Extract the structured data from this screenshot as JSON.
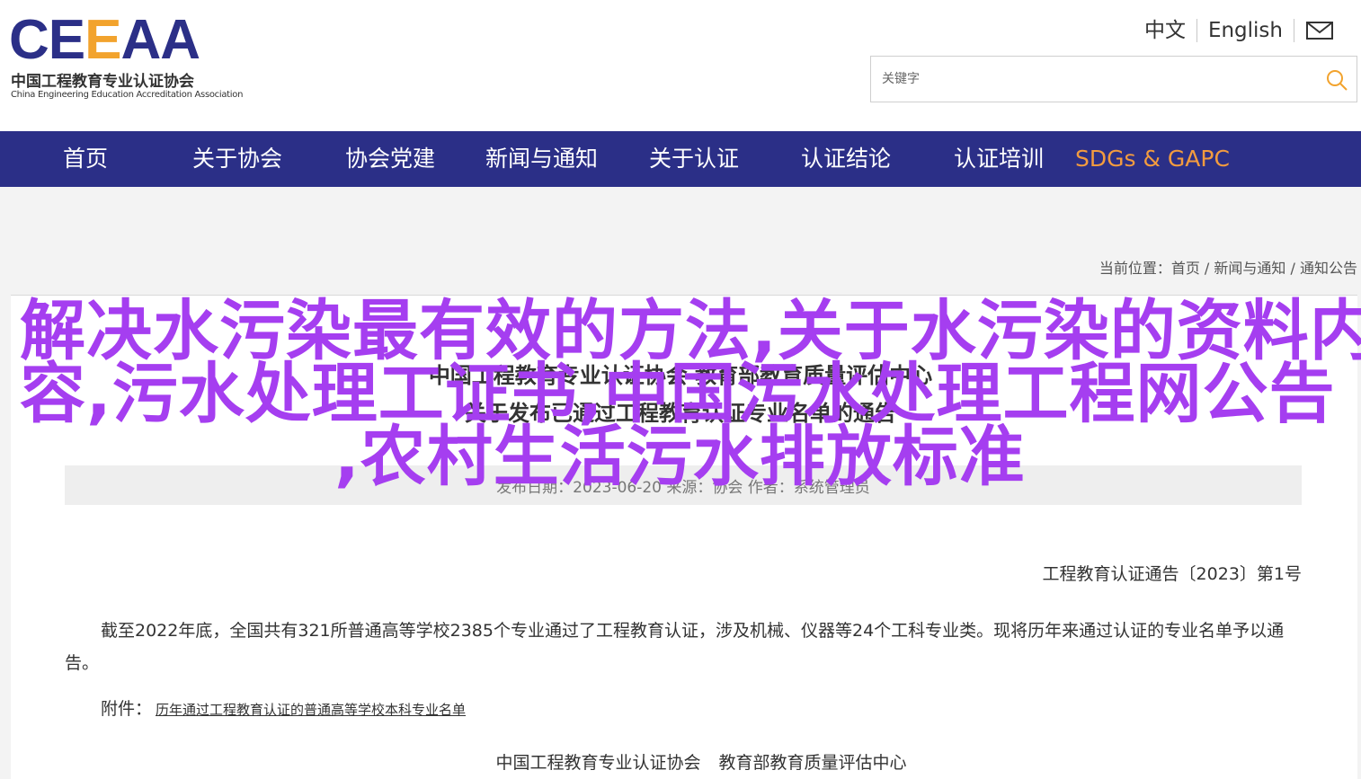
{
  "header": {
    "logo": {
      "mark": "CEEAA",
      "mark_prefix": "CE",
      "mark_accent": "E",
      "mark_suffix": "AA",
      "cn": "中国工程教育专业认证协会",
      "en": "China Engineering Education Accreditation Association"
    },
    "lang": {
      "zh": "中文",
      "en": "English"
    },
    "mail_icon": "mail-icon",
    "search": {
      "placeholder": "关键字",
      "icon": "search-icon"
    }
  },
  "nav": {
    "items": [
      "首页",
      "关于协会",
      "协会党建",
      "新闻与通知",
      "关于认证",
      "认证结论",
      "认证培训",
      "SDGs & GAPC"
    ]
  },
  "breadcrumb": {
    "label": "当前位置：",
    "items": [
      "首页",
      "新闻与通知",
      "通知公告"
    ],
    "sep": " / "
  },
  "article": {
    "title_line1": "中国工程教育专业认证协会 教育部教育质量评估中心",
    "title_line2": "关于发布已通过工程教育认证专业名单的通告",
    "meta": "发布日期：2023-06-20    来源：协会    作者：系统管理员",
    "notice_no": "工程教育认证通告〔2023〕第1号",
    "paragraph": "截至2022年底，全国共有321所普通高等学校2385个专业通过了工程教育认证，涉及机械、仪器等24个工科专业类。现将历年来通过认证的专业名单予以通告。",
    "attachment_label": "附件：",
    "attachment_link": "历年通过工程教育认证的普通高等学校本科专业名单",
    "signature": [
      "中国工程教育专业认证协会",
      "教育部教育质量评估中心"
    ]
  },
  "overlay": {
    "line1": "解决水污染最有效的方法,关于水污染的资料内",
    "line2": "容,污水处理工证书,中国污水处理工程网公告",
    "line3": ",农村生活污水排放标准"
  },
  "colors": {
    "nav_bg": "#2b2f87",
    "accent_orange": "#f29b3f",
    "overlay_text": "#a53ef0",
    "logo_accent": "#f2a32d"
  }
}
